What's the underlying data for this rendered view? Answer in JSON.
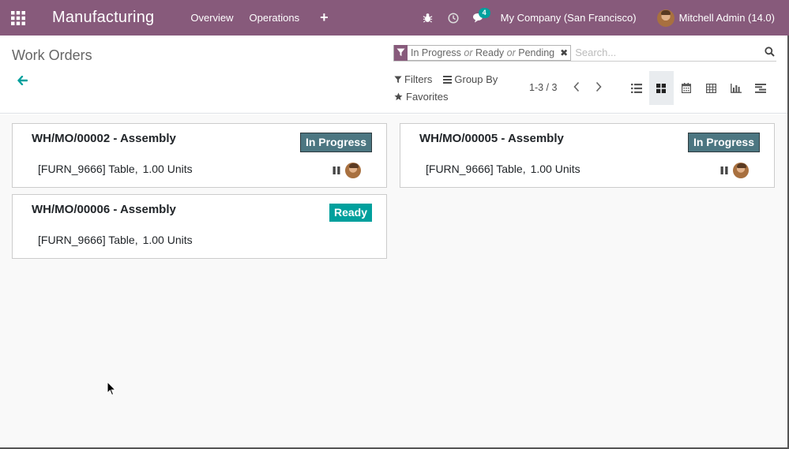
{
  "navbar": {
    "brand": "Manufacturing",
    "menu": [
      "Overview",
      "Operations"
    ],
    "plus": "+",
    "messages_count": "4",
    "company": "My Company (San Francisco)",
    "user": "Mitchell Admin (14.0)",
    "colors": {
      "bg": "#875a7b",
      "badge": "#00a09d"
    }
  },
  "control_panel": {
    "title": "Work Orders",
    "facet": {
      "values": [
        "In Progress",
        "Ready",
        "Pending"
      ],
      "separator": "or"
    },
    "search_placeholder": "Search...",
    "filters_label": "Filters",
    "group_by_label": "Group By",
    "favorites_label": "Favorites",
    "pager": "1-3 / 3",
    "views": [
      "list",
      "kanban",
      "calendar",
      "pivot",
      "graph",
      "gantt"
    ],
    "active_view": "kanban"
  },
  "cards": [
    {
      "title": "WH/MO/00002 - Assembly",
      "status": "In Progress",
      "product": "[FURN_9666] Table",
      "qty": "1.00 Units",
      "show_actions": true
    },
    {
      "title": "WH/MO/00005 - Assembly",
      "status": "In Progress",
      "product": "[FURN_9666] Table",
      "qty": "1.00 Units",
      "show_actions": true
    },
    {
      "title": "WH/MO/00006 - Assembly",
      "status": "Ready",
      "product": "[FURN_9666] Table",
      "qty": "1.00 Units",
      "show_actions": false
    }
  ]
}
